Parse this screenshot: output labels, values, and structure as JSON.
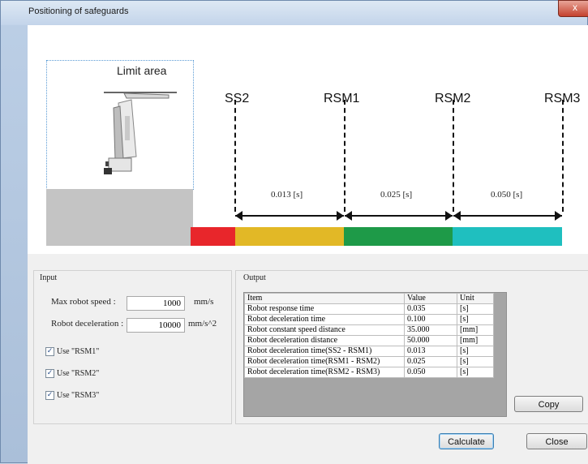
{
  "window": {
    "title": "Positioning of safeguards",
    "close_glyph": "x"
  },
  "diagram": {
    "limit_area_label": "Limit area",
    "markers": [
      "SS2",
      "RSM1",
      "RSM2",
      "RSM3"
    ],
    "intervals": [
      "0.013 [s]",
      "0.025 [s]",
      "0.050 [s]"
    ],
    "colors": {
      "red": "#e8262b",
      "yellow": "#e2b826",
      "green": "#1e9a48",
      "teal": "#1fbfbf",
      "ground": "#c4c4c4"
    }
  },
  "input": {
    "title": "Input",
    "max_speed_label": "Max robot speed :",
    "max_speed_value": "1000",
    "max_speed_unit": "mm/s",
    "decel_label": "Robot deceleration :",
    "decel_value": "10000",
    "decel_unit": "mm/s^2",
    "checkboxes": [
      {
        "label": "Use \"RSM1\"",
        "checked": true
      },
      {
        "label": "Use \"RSM2\"",
        "checked": true
      },
      {
        "label": "Use \"RSM3\"",
        "checked": true
      }
    ]
  },
  "output": {
    "title": "Output",
    "headers": [
      "Item",
      "Value",
      "Unit"
    ],
    "rows": [
      [
        "Robot response time",
        "0.035",
        "[s]"
      ],
      [
        "Robot deceleration time",
        "0.100",
        "[s]"
      ],
      [
        "Robot constant speed distance",
        "35.000",
        "[mm]"
      ],
      [
        "Robot deceleration distance",
        "50.000",
        "[mm]"
      ],
      [
        "Robot deceleration time(SS2 - RSM1)",
        "0.013",
        "[s]"
      ],
      [
        "Robot deceleration time(RSM1 - RSM2)",
        "0.025",
        "[s]"
      ],
      [
        "Robot deceleration time(RSM2 - RSM3)",
        "0.050",
        "[s]"
      ]
    ],
    "copy_label": "Copy"
  },
  "buttons": {
    "calculate": "Calculate",
    "close": "Close"
  }
}
